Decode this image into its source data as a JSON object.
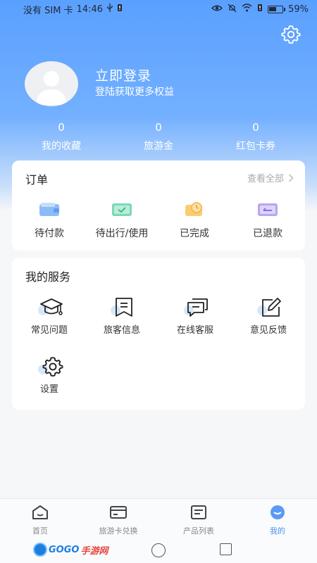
{
  "status_bar": {
    "carrier": "没有 SIM 卡",
    "time": "14:46",
    "battery_text": "59%",
    "battery_level": 0.59
  },
  "profile": {
    "login_title": "立即登录",
    "login_subtitle": "登陆获取更多权益"
  },
  "stats": [
    {
      "value": "0",
      "label": "我的收藏"
    },
    {
      "value": "0",
      "label": "旅游金"
    },
    {
      "value": "0",
      "label": "红包卡券"
    }
  ],
  "orders": {
    "title": "订单",
    "view_all": "查看全部",
    "items": [
      {
        "label": "待付款",
        "icon": "wallet-icon",
        "color": "#6fa8f5"
      },
      {
        "label": "待出行/使用",
        "icon": "ticket-check-icon",
        "color": "#5fcfa7"
      },
      {
        "label": "已完成",
        "icon": "clock-done-icon",
        "color": "#f7c15a"
      },
      {
        "label": "已退款",
        "icon": "refund-icon",
        "color": "#a993ef"
      }
    ]
  },
  "services": {
    "title": "我的服务",
    "items": [
      {
        "label": "常见问题",
        "icon": "graduation-cap-icon"
      },
      {
        "label": "旅客信息",
        "icon": "bookmark-icon"
      },
      {
        "label": "在线客服",
        "icon": "chat-icon"
      },
      {
        "label": "意见反馈",
        "icon": "edit-icon"
      },
      {
        "label": "设置",
        "icon": "gear-icon"
      }
    ]
  },
  "tabbar": [
    {
      "label": "首页",
      "icon": "home-icon"
    },
    {
      "label": "旅游卡兑换",
      "icon": "card-icon"
    },
    {
      "label": "产品列表",
      "icon": "list-icon"
    },
    {
      "label": "我的",
      "icon": "profile-icon"
    }
  ],
  "colors": {
    "accent": "#4d8ff2",
    "hero_top": "#5aa0ff"
  },
  "watermark": {
    "brand": "GOGO",
    "brand_suffix": "手游网"
  }
}
